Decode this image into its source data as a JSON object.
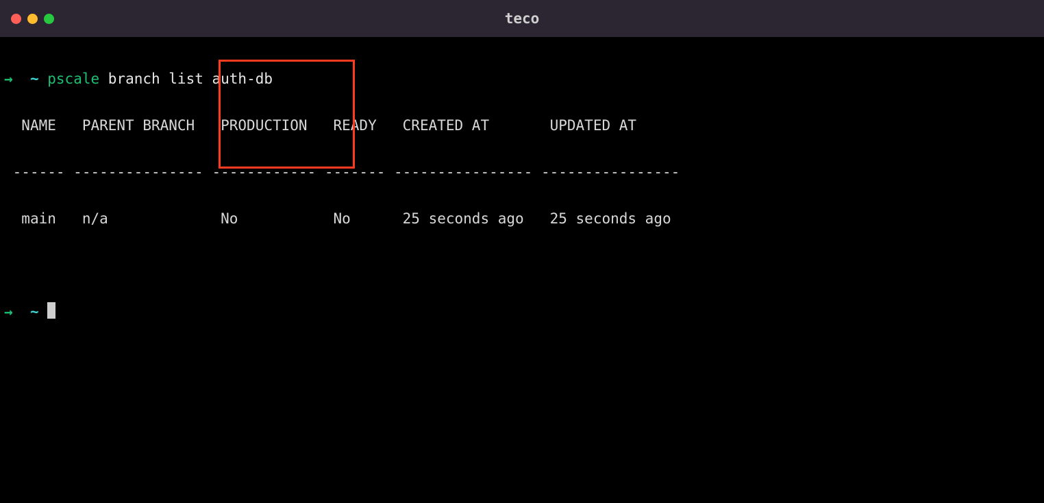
{
  "window": {
    "title": "teco"
  },
  "prompt": {
    "arrow": "→",
    "tilde": "~",
    "command": "pscale",
    "args": "branch list auth-db"
  },
  "table": {
    "headers": {
      "name": "NAME",
      "parent_branch": "PARENT BRANCH",
      "production": "PRODUCTION",
      "ready": "READY",
      "created_at": "CREATED AT",
      "updated_at": "UPDATED AT"
    },
    "separators": {
      "name": "------",
      "parent_branch": "---------------",
      "production": "------------",
      "ready": "-------",
      "created_at": "----------------",
      "updated_at": "----------------"
    },
    "row": {
      "name": "main",
      "parent_branch": "n/a",
      "production": "No",
      "ready": "No",
      "created_at": "25 seconds ago",
      "updated_at": "25 seconds ago"
    }
  },
  "highlight": {
    "column": "PRODUCTION"
  }
}
